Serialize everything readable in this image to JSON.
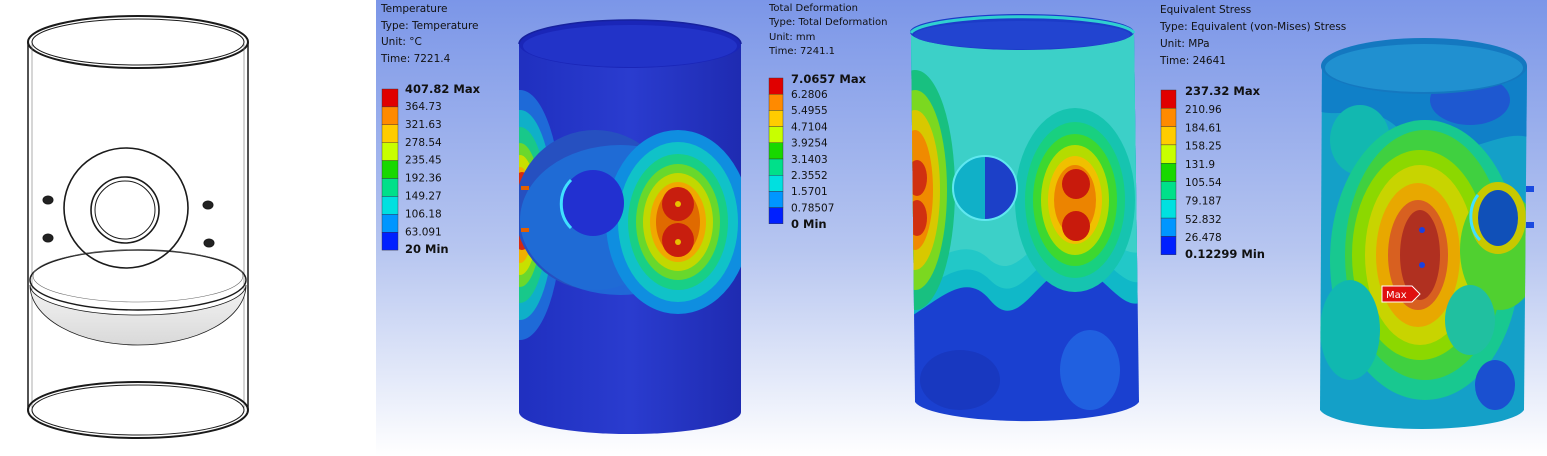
{
  "panels": [
    {
      "title": "Temperature",
      "type_line": "Type: Temperature",
      "unit_line": "Unit: °C",
      "time_line": "Time: 7221.4",
      "max_label": "407.82 Max",
      "ticks": [
        "364.73",
        "321.63",
        "278.54",
        "235.45",
        "192.36",
        "149.27",
        "106.18",
        "63.091"
      ],
      "min_label": "20 Min"
    },
    {
      "title": "Total Deformation",
      "type_line": "Type: Total Deformation",
      "unit_line": "Unit: mm",
      "time_line": "Time: 7241.1",
      "max_label": "7.0657 Max",
      "ticks": [
        "6.2806",
        "5.4955",
        "4.7104",
        "3.9254",
        "3.1403",
        "2.3552",
        "1.5701",
        "0.78507"
      ],
      "min_label": "0 Min"
    },
    {
      "title": "Equivalent Stress",
      "type_line": "Type: Equivalent (von-Mises) Stress",
      "unit_line": "Unit: MPa",
      "time_line": "Time: 24641",
      "max_label": "237.32 Max",
      "ticks": [
        "210.96",
        "184.61",
        "158.25",
        "131.9",
        "105.54",
        "79.187",
        "52.832",
        "26.478"
      ],
      "min_label": "0.12299 Min"
    }
  ],
  "max_probe_label": "Max",
  "legend_colors": [
    "#e00000",
    "#ff8a00",
    "#ffcc00",
    "#c8ff00",
    "#18d800",
    "#00e08a",
    "#00e0e0",
    "#0096ff",
    "#0020ff"
  ]
}
